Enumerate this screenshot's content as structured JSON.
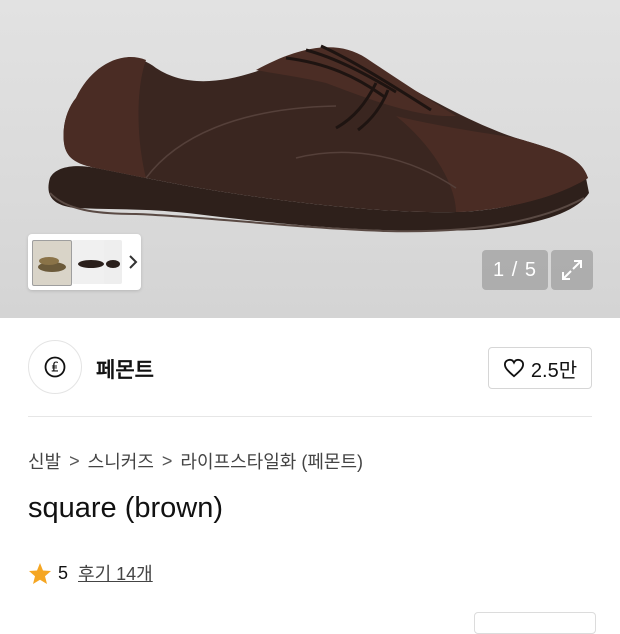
{
  "gallery": {
    "counter": "1 / 5",
    "thumbnail_count_visible": 3
  },
  "brand": {
    "name": "페몬트",
    "logo_glyph": "₤",
    "likes": "2.5만"
  },
  "breadcrumb": {
    "items": [
      "신발",
      "스니커즈",
      "라이프스타일화 (페몬트)"
    ],
    "separator": ">"
  },
  "product": {
    "title": "square (brown)",
    "rating": "5",
    "reviews_label": "후기 14개"
  },
  "colors": {
    "star": "#f5a623",
    "shoe_leather": "#3a2620",
    "shoe_suede": "#4a2c24"
  },
  "icons": {
    "heart": "heart-icon",
    "expand": "expand-icon",
    "chevron": "chevron-right-icon",
    "star": "star-icon"
  }
}
